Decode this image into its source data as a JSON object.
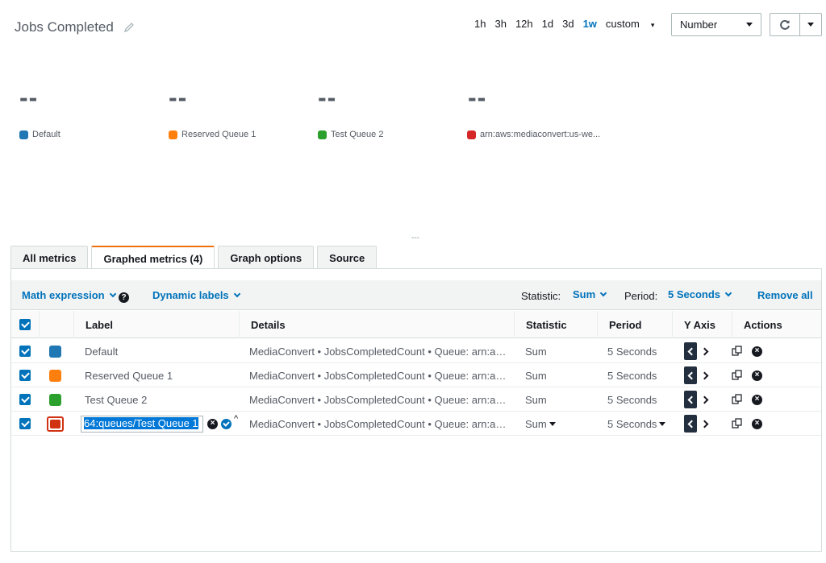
{
  "header": {
    "title": "Jobs Completed",
    "time_ranges": [
      "1h",
      "3h",
      "12h",
      "1d",
      "3d",
      "1w",
      "custom"
    ],
    "active_range": "1w",
    "view_select": "Number",
    "edit_icon": "pencil-icon",
    "refresh_icon": "refresh-icon"
  },
  "summary": [
    {
      "value": "--",
      "legend": "Default",
      "color": "#1f77b4"
    },
    {
      "value": "--",
      "legend": "Reserved Queue 1",
      "color": "#ff7f0e"
    },
    {
      "value": "--",
      "legend": "Test Queue 2",
      "color": "#2ca02c"
    },
    {
      "value": "--",
      "legend": "arn:aws:mediaconvert:us-we...",
      "color": "#d62728"
    }
  ],
  "resize_handle": "---",
  "tabs": [
    "All metrics",
    "Graphed metrics (4)",
    "Graph options",
    "Source"
  ],
  "active_tab": "Graphed metrics (4)",
  "toolbar": {
    "math_expression": "Math expression",
    "dynamic_labels": "Dynamic labels",
    "statistic_label": "Statistic:",
    "statistic_value": "Sum",
    "period_label": "Period:",
    "period_value": "5 Seconds",
    "remove_all": "Remove all",
    "help_icon": "?"
  },
  "columns": [
    "Label",
    "Details",
    "Statistic",
    "Period",
    "Y Axis",
    "Actions"
  ],
  "rows": [
    {
      "label": "Default",
      "details": "MediaConvert • JobsCompletedCount • Queue: arn:a…",
      "statistic": "Sum",
      "period": "5 Seconds",
      "color": "#1f77b4"
    },
    {
      "label": "Reserved Queue 1",
      "details": "MediaConvert • JobsCompletedCount • Queue: arn:a…",
      "statistic": "Sum",
      "period": "5 Seconds",
      "color": "#ff7f0e"
    },
    {
      "label": "Test Queue 2",
      "details": "MediaConvert • JobsCompletedCount • Queue: arn:a…",
      "statistic": "Sum",
      "period": "5 Seconds",
      "color": "#2ca02c"
    },
    {
      "label": "64:queues/Test Queue 1",
      "details": "MediaConvert • JobsCompletedCount • Queue: arn:a…",
      "statistic": "Sum",
      "period": "5 Seconds",
      "color": "#d13212"
    }
  ]
}
